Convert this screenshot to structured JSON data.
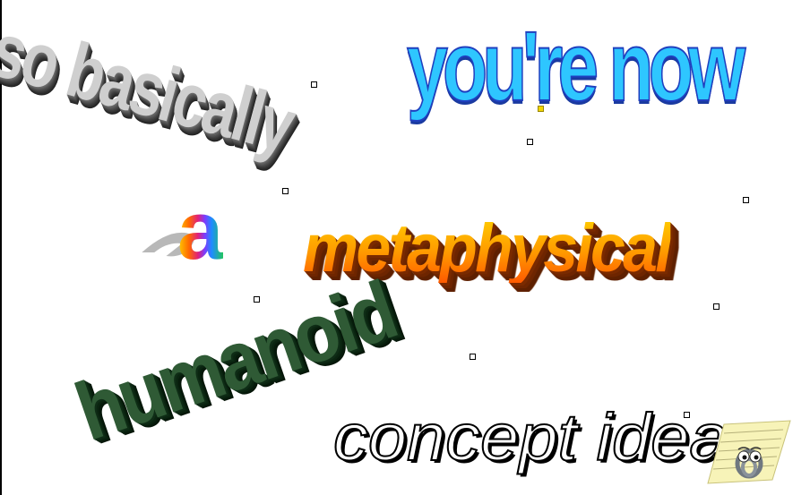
{
  "wordart": {
    "line1": "so basically",
    "line2": "you're now",
    "line3": "a",
    "line4": "metaphysical",
    "line5": "humanoid",
    "line6": "concept idea"
  },
  "colors": {
    "grey_face": "#cfcfcf",
    "blue_face": "#2ec6ff",
    "blue_outline": "#1f3fbf",
    "orange_face": "#ff9a00",
    "orange_shadow": "#7a2a00",
    "green_face": "#2f5a35",
    "outline": "#000000"
  },
  "icons": {
    "assistant": "paperclip-assistant-icon",
    "handle": "selection-handle-icon"
  }
}
